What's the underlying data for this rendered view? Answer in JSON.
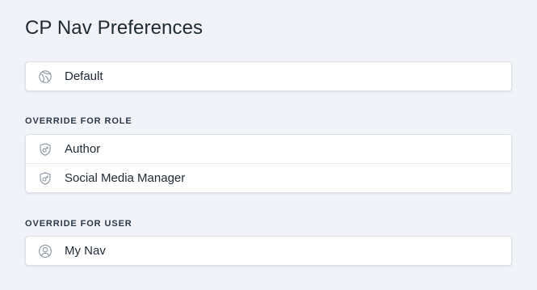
{
  "page": {
    "title": "CP Nav Preferences"
  },
  "default_section": {
    "items": [
      {
        "label": "Default",
        "icon": "globe-icon"
      }
    ]
  },
  "role_section": {
    "heading": "OVERRIDE FOR ROLE",
    "items": [
      {
        "label": "Author",
        "icon": "shield-key-icon"
      },
      {
        "label": "Social Media Manager",
        "icon": "shield-key-icon"
      }
    ]
  },
  "user_section": {
    "heading": "OVERRIDE FOR USER",
    "items": [
      {
        "label": "My Nav",
        "icon": "user-icon"
      }
    ]
  },
  "colors": {
    "background": "#f1f3f9",
    "card": "#ffffff",
    "border": "#dde1e6",
    "text": "#1f2933",
    "icon": "#8a94a0"
  }
}
